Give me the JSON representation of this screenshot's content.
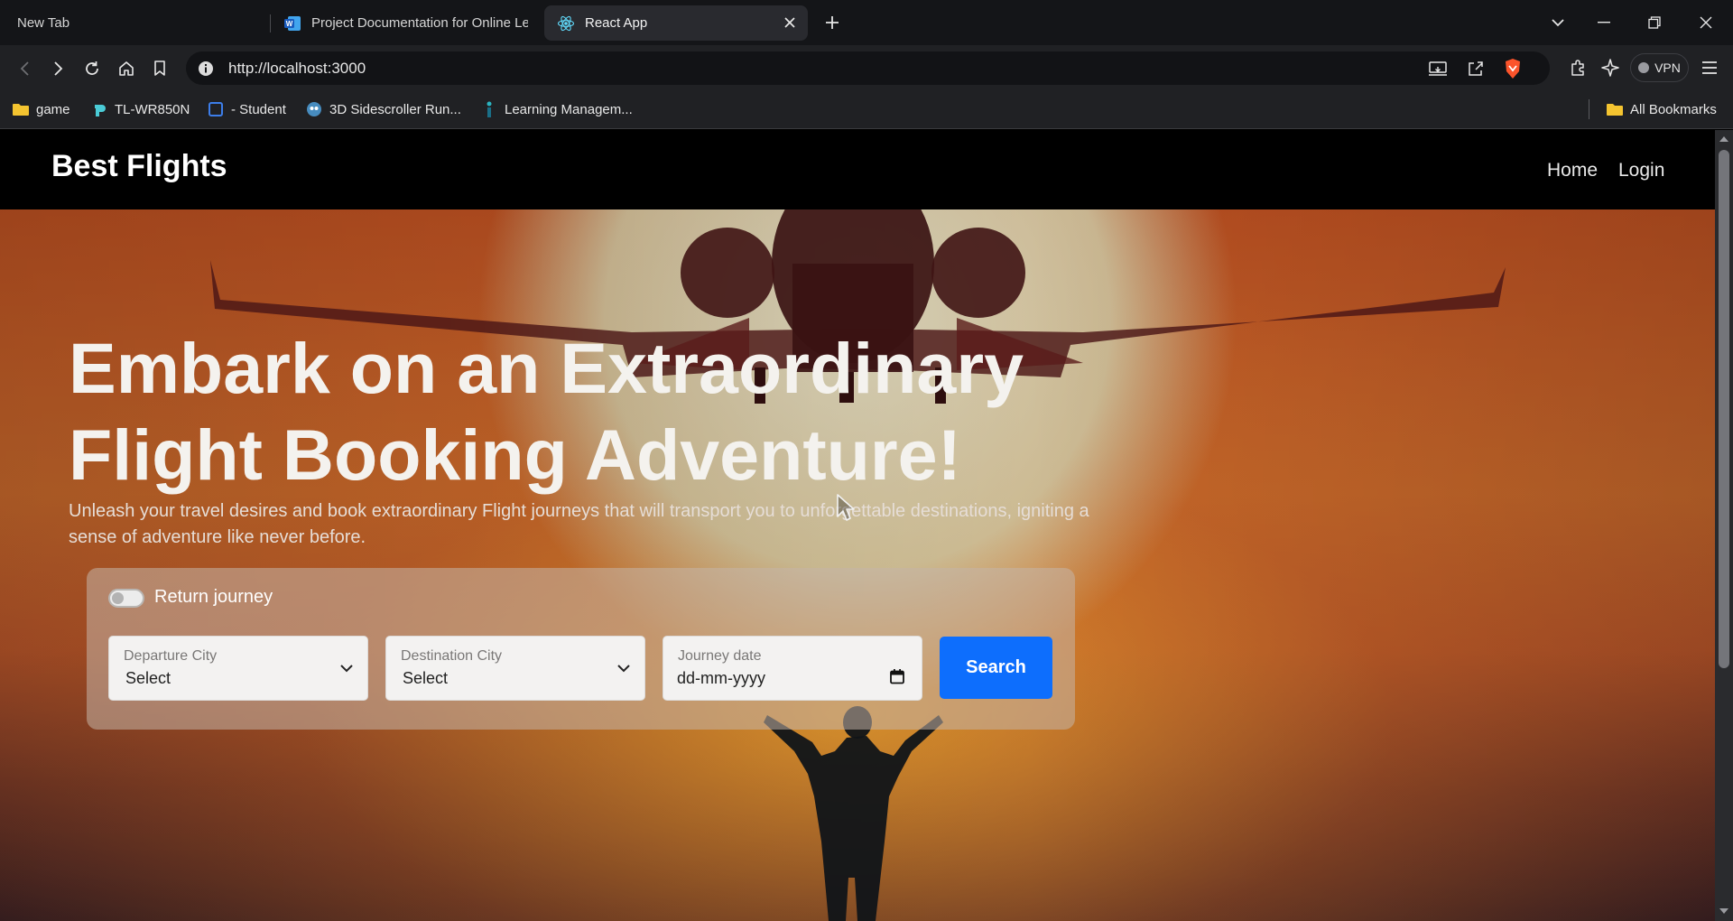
{
  "browser": {
    "tabs": [
      {
        "title": "New Tab"
      },
      {
        "title": "Project Documentation for Online Learning"
      },
      {
        "title": "React App"
      }
    ],
    "address": {
      "url": "http://localhost:3000"
    },
    "vpn_label": "VPN",
    "bookmarks": [
      {
        "label": "game",
        "icon": "folder-icon"
      },
      {
        "label": "TL-WR850N",
        "icon": "tplink-icon"
      },
      {
        "label": "- Student",
        "icon": "student-icon"
      },
      {
        "label": "3D Sidescroller Run...",
        "icon": "game-icon"
      },
      {
        "label": "Learning Managem...",
        "icon": "lms-icon"
      }
    ],
    "all_bookmarks_label": "All Bookmarks"
  },
  "page": {
    "navbar": {
      "brand": "Best Flights",
      "links": [
        {
          "label": "Home"
        },
        {
          "label": "Login"
        }
      ]
    },
    "hero": {
      "headline_line1": "Embark on an Extraordinary",
      "headline_line2": "Flight Booking Adventure!",
      "subtext": "Unleash your travel desires and book extraordinary Flight journeys that will transport you to unforgettable destinations, igniting a sense of adventure like never before."
    },
    "search": {
      "return_journey_label": "Return journey",
      "return_journey_checked": false,
      "departure": {
        "label": "Departure City",
        "value": "Select"
      },
      "destination": {
        "label": "Destination City",
        "value": "Select"
      },
      "date": {
        "label": "Journey date",
        "placeholder": "dd-mm-yyyy"
      },
      "button_label": "Search"
    }
  },
  "colors": {
    "accent": "#0d6efd",
    "navbar_bg": "#000000",
    "browser_chrome": "#202124"
  }
}
